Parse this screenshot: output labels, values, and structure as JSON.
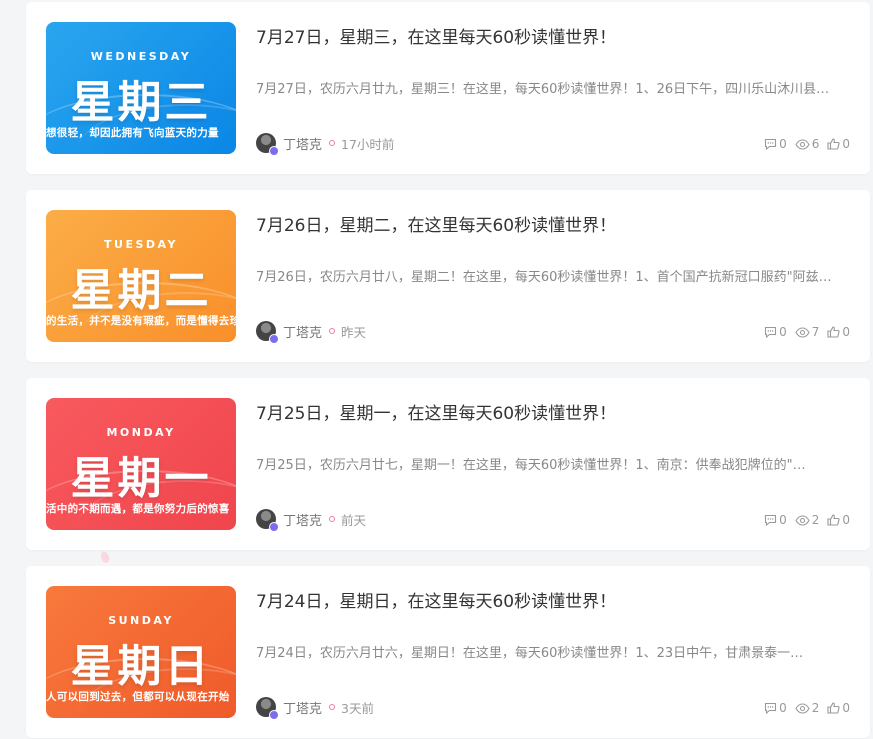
{
  "posts": [
    {
      "day_en": "WEDNESDAY",
      "day_cn": "星期三",
      "quote": "想很轻，却因此拥有飞向蓝天的力量",
      "gradient": [
        "#2aa6ef",
        "#0a86e6"
      ],
      "title": "7月27日，星期三，在这里每天60秒读懂世界！",
      "excerpt": "7月27日，农历六月廿九，星期三！在这里，每天60秒读懂世界！1、26日下午，四川乐山沐川县发生地震…",
      "author": "丁塔克",
      "time": "17小时前",
      "comments": "0",
      "views": "6",
      "likes": "0"
    },
    {
      "day_en": "TUESDAY",
      "day_cn": "星期二",
      "quote": "的生活，并不是没有瑕疵，而是懂得去珍惜",
      "gradient": [
        "#fbad47",
        "#f98f2a"
      ],
      "title": "7月26日，星期二，在这里每天60秒读懂世界！",
      "excerpt": "7月26日，农历六月廿八，星期二！在这里，每天60秒读懂世界！1、首个国产抗新冠口服药\"阿兹夫定…",
      "author": "丁塔克",
      "time": "昨天",
      "comments": "0",
      "views": "7",
      "likes": "0"
    },
    {
      "day_en": "MONDAY",
      "day_cn": "星期一",
      "quote": "活中的不期而遇，都是你努力后的惊喜",
      "gradient": [
        "#f85a5e",
        "#f0454d"
      ],
      "title": "7月25日，星期一，在这里每天60秒读懂世界！",
      "excerpt": "7月25日，农历六月廿七，星期一！在这里，每天60秒读懂世界！1、南京：供奉战犯牌位的\"…",
      "author": "丁塔克",
      "time": "前天",
      "comments": "0",
      "views": "2",
      "likes": "0"
    },
    {
      "day_en": "SUNDAY",
      "day_cn": "星期日",
      "quote": "人可以回到过去，但都可以从现在开始",
      "gradient": [
        "#f8793c",
        "#ef5a2a"
      ],
      "title": "7月24日，星期日，在这里每天60秒读懂世界！",
      "excerpt": "7月24日，农历六月廿六，星期日！在这里，每天60秒读懂世界！1、23日中午，甘肃景泰一…",
      "author": "丁塔克",
      "time": "3天前",
      "comments": "0",
      "views": "2",
      "likes": "0"
    }
  ]
}
